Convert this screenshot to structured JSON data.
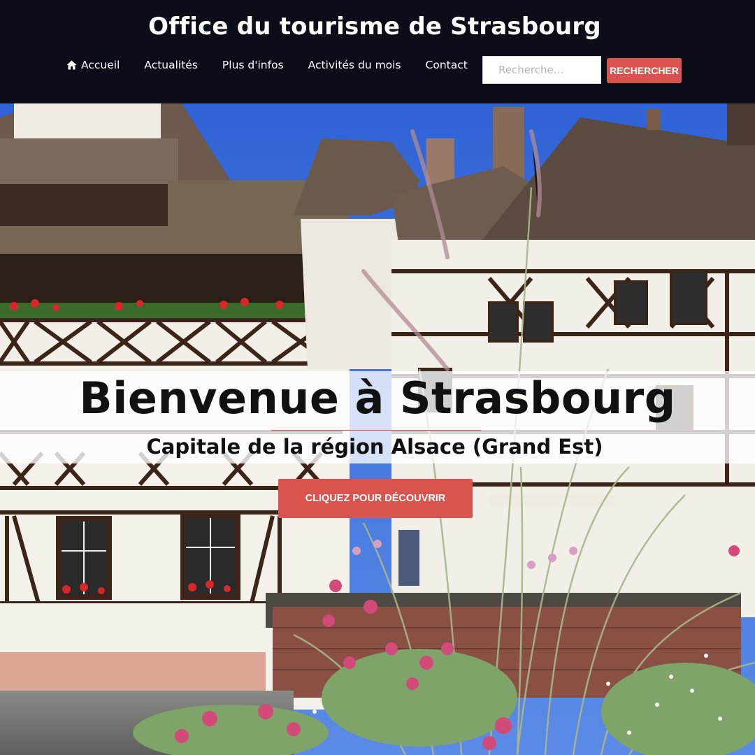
{
  "site": {
    "title": "Office du tourisme de Strasbourg"
  },
  "nav": {
    "items": [
      {
        "label": "Accueil",
        "icon": "home-icon"
      },
      {
        "label": "Actualités"
      },
      {
        "label": "Plus d'infos"
      },
      {
        "label": "Activités du mois"
      },
      {
        "label": "Contact"
      }
    ]
  },
  "search": {
    "placeholder": "Recherche...",
    "value": "",
    "button_label": "RECHERCHER"
  },
  "hero": {
    "title": "Bienvenue à Strasbourg",
    "subtitle": "Capitale de la région Alsace (Grand Est)",
    "cta_label": "CLIQUEZ POUR DÉCOUVRIR",
    "photo": "half-timbered-houses-la-petite-france"
  },
  "colors": {
    "header_bg": "#0b0e18",
    "accent": "#d9534f",
    "text_dark": "#111111",
    "text_light": "#ffffff"
  }
}
